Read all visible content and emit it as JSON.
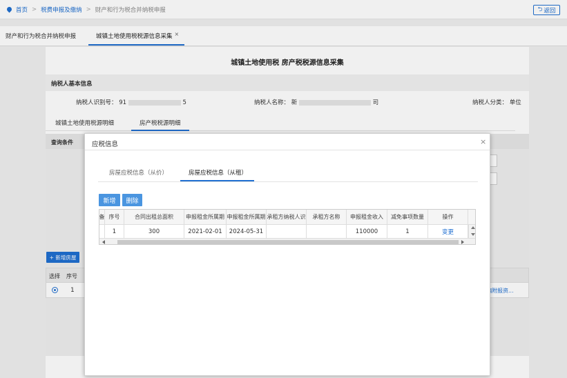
{
  "breadcrumb": {
    "home": "首页",
    "level1": "税费申报及缴纳",
    "level2": "财产和行为税合并纳税申报"
  },
  "header": {
    "back_label": "返回"
  },
  "tabs": [
    {
      "label": "财产和行为税合并纳税申报"
    },
    {
      "label": "城镇土地使用税税源信息采集",
      "close": "×"
    }
  ],
  "page": {
    "title": "城镇土地使用税  房产税税源信息采集",
    "section_title": "纳税人基本信息",
    "taxpayer_id_label": "纳税人识别号：",
    "taxpayer_id_prefix": "91",
    "taxpayer_id_suffix": "5",
    "taxpayer_name_label": "纳税人名称：",
    "taxpayer_name_prefix": "新",
    "taxpayer_name_suffix": "司",
    "taxpayer_type_label": "纳税人分类：",
    "taxpayer_type_value": "单位",
    "subtabs": [
      "城镇土地使用税源明细",
      "房产税税源明细"
    ],
    "query_head": "查询条件",
    "add_house_label": "+ 新增房屋",
    "bg_table": {
      "headers": [
        "选择",
        "序号"
      ],
      "row": {
        "index": "1",
        "link": "编附报资..."
      }
    }
  },
  "modal": {
    "title": "应税信息",
    "close": "×",
    "tabs": [
      "房屋应税信息（从价）",
      "房屋应税信息（从租）"
    ],
    "buttons": {
      "add": "新增",
      "delete": "删除"
    },
    "table": {
      "headers": [
        "备",
        "序号",
        "合同出租总面积",
        "申报租金所属期",
        "申报租金所属期",
        "承租方纳税人识",
        "承租方名称",
        "申报租金收入",
        "减免事项数量",
        "操作"
      ],
      "rows": [
        [
          "",
          "1",
          "300",
          "2021-02-01",
          "2024-05-31",
          "",
          "",
          "110000",
          "1",
          "变更"
        ]
      ]
    }
  }
}
